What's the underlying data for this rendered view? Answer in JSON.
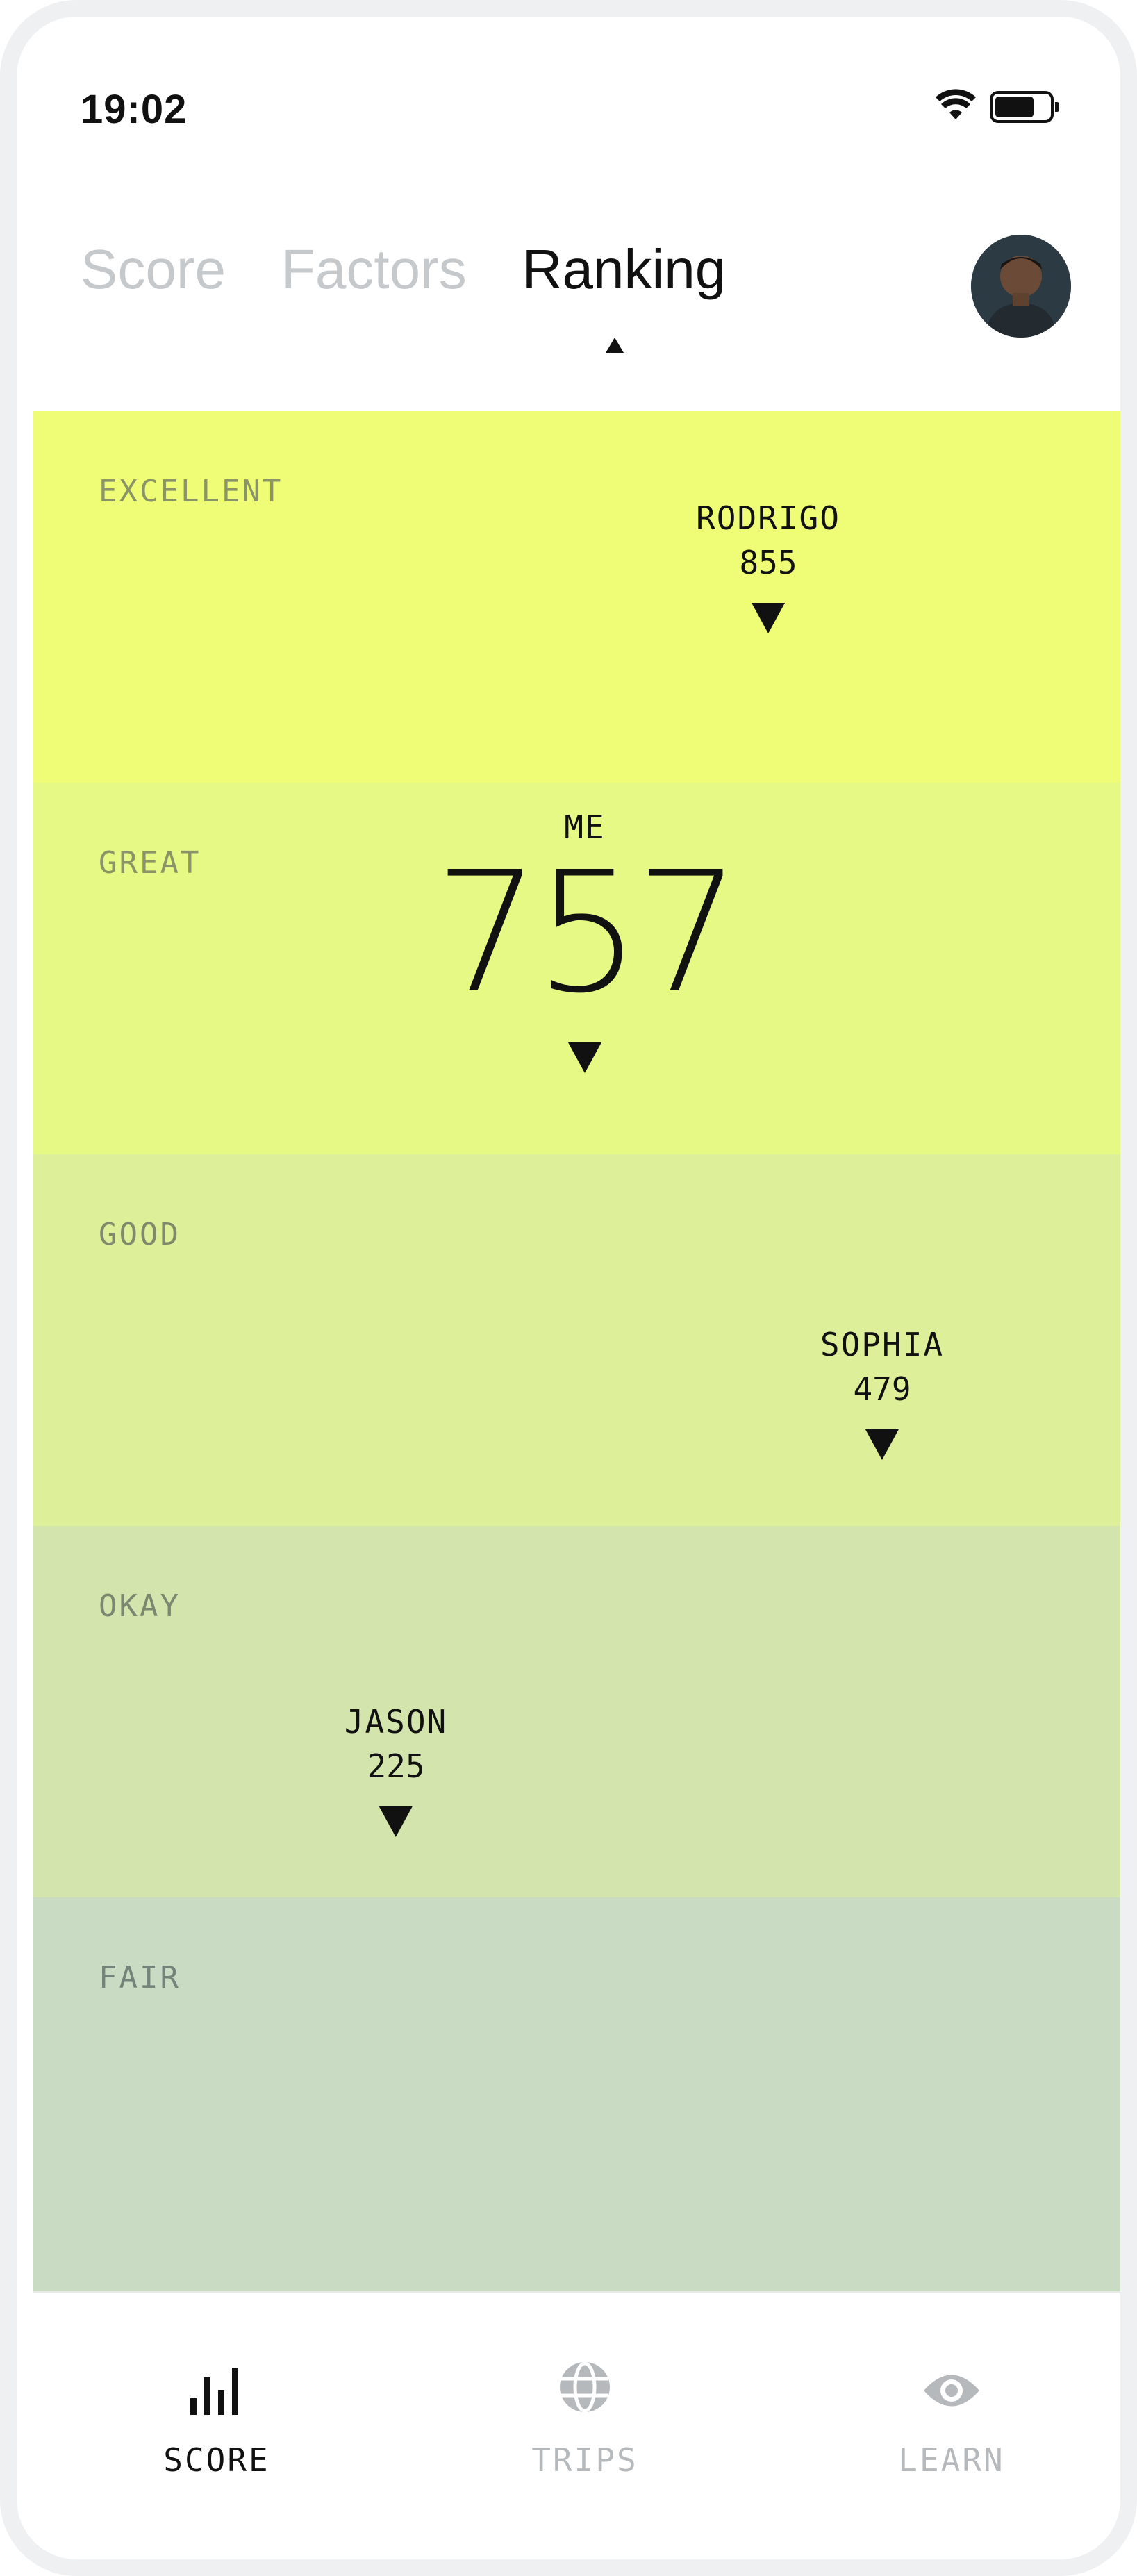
{
  "status": {
    "time": "19:02"
  },
  "tabs": [
    {
      "label": "Score",
      "active": false
    },
    {
      "label": "Factors",
      "active": false
    },
    {
      "label": "Ranking",
      "active": true
    }
  ],
  "bands": [
    {
      "label": "EXCELLENT",
      "color": "#eefd75",
      "label_color": "#8a9467"
    },
    {
      "label": "GREAT",
      "color": "#e6f985",
      "label_color": "#8a9467"
    },
    {
      "label": "GOOD",
      "color": "#ddef98",
      "label_color": "#7e8a6a"
    },
    {
      "label": "OKAY",
      "color": "#d3e5ac",
      "label_color": "#7b8770"
    },
    {
      "label": "FAIR",
      "color": "#c9dcc3",
      "label_color": "#75837a"
    }
  ],
  "ranking": {
    "rodrigo": {
      "name": "RODRIGO",
      "score": "855"
    },
    "me": {
      "name": "ME",
      "score": "757"
    },
    "sophia": {
      "name": "SOPHIA",
      "score": "479"
    },
    "jason": {
      "name": "JASON",
      "score": "225"
    }
  },
  "bottom_nav": [
    {
      "label": "SCORE",
      "icon": "bar-chart-icon",
      "active": true
    },
    {
      "label": "TRIPS",
      "icon": "globe-icon",
      "active": false
    },
    {
      "label": "LEARN",
      "icon": "eye-icon",
      "active": false
    }
  ],
  "colors": {
    "active": "#111111",
    "inactive": "#b6b9bb"
  }
}
